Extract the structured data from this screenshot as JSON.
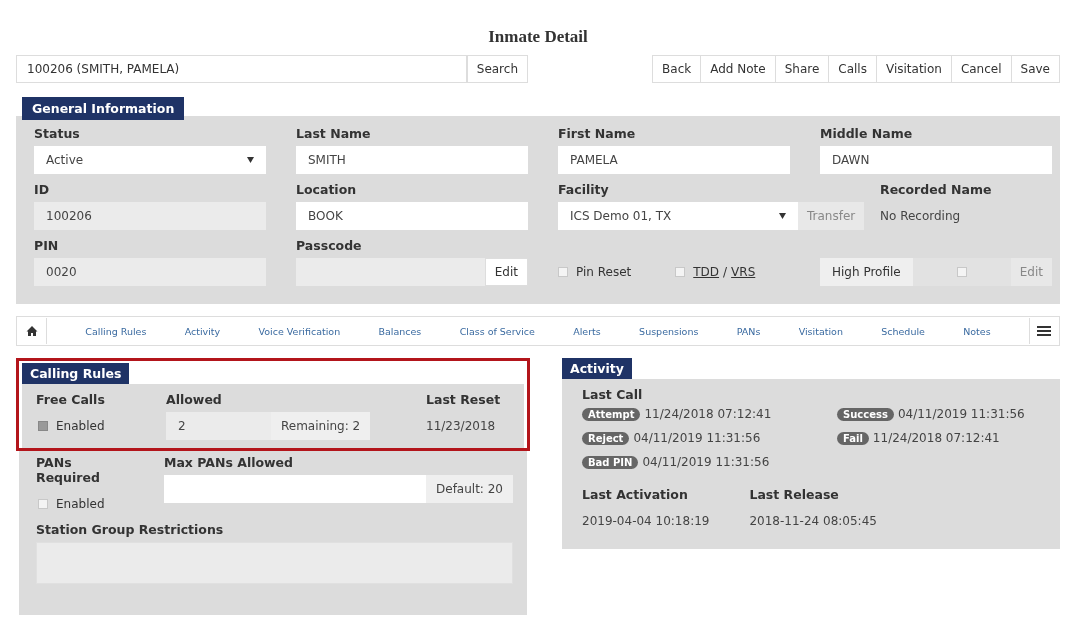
{
  "page_title": "Inmate Detail",
  "search": {
    "value": "100206 (SMITH, PAMELA)",
    "button": "Search"
  },
  "actions": [
    "Back",
    "Add Note",
    "Share",
    "Calls",
    "Visitation",
    "Cancel",
    "Save"
  ],
  "general": {
    "title": "General Information",
    "status": {
      "label": "Status",
      "value": "Active"
    },
    "last_name": {
      "label": "Last Name",
      "value": "SMITH"
    },
    "first_name": {
      "label": "First Name",
      "value": "PAMELA"
    },
    "middle_name": {
      "label": "Middle Name",
      "value": "DAWN"
    },
    "id": {
      "label": "ID",
      "value": "100206"
    },
    "location": {
      "label": "Location",
      "value": "BOOK"
    },
    "facility": {
      "label": "Facility",
      "value": "ICS Demo 01, TX",
      "button": "Transfer"
    },
    "recorded_name": {
      "label": "Recorded Name",
      "value": "No Recording"
    },
    "pin": {
      "label": "PIN",
      "value": "0020"
    },
    "passcode": {
      "label": "Passcode",
      "button": "Edit"
    },
    "pin_reset": {
      "label": "Pin Reset",
      "checked": false
    },
    "tdd": {
      "link1": "TDD",
      "sep": "/",
      "link2": "VRS",
      "checked": false
    },
    "high_profile": {
      "label": "High Profile",
      "checked": false,
      "button": "Edit"
    }
  },
  "nav": {
    "items": [
      "Calling Rules",
      "Activity",
      "Voice Verification",
      "Balances",
      "Class of Service",
      "Alerts",
      "Suspensions",
      "PANs",
      "Visitation",
      "Schedule",
      "Notes"
    ]
  },
  "calling_rules": {
    "title": "Calling Rules",
    "highlighted": true,
    "free_calls": {
      "label": "Free Calls",
      "option": "Enabled",
      "checked": true
    },
    "allowed": {
      "label": "Allowed",
      "value": "2",
      "remaining": "Remaining: 2"
    },
    "last_reset": {
      "label": "Last Reset",
      "value": "11/23/2018"
    },
    "pans_required": {
      "label": "PANs Required",
      "option": "Enabled",
      "checked": false
    },
    "max_pans": {
      "label": "Max PANs Allowed",
      "default": "Default: 20"
    },
    "station_group": {
      "label": "Station Group Restrictions"
    }
  },
  "activity": {
    "title": "Activity",
    "last_call_label": "Last Call",
    "events": [
      {
        "badge": "Attempt",
        "time": "11/24/2018 07:12:41"
      },
      {
        "badge": "Success",
        "time": "04/11/2019 11:31:56"
      },
      {
        "badge": "Reject",
        "time": "04/11/2019 11:31:56"
      },
      {
        "badge": "Fail",
        "time": "11/24/2018 07:12:41"
      },
      {
        "badge": "Bad PIN",
        "time": "04/11/2019 11:31:56"
      }
    ],
    "last_activation": {
      "label": "Last Activation",
      "value": "2019-04-04 10:18:19"
    },
    "last_release": {
      "label": "Last Release",
      "value": "2018-11-24 08:05:45"
    }
  }
}
